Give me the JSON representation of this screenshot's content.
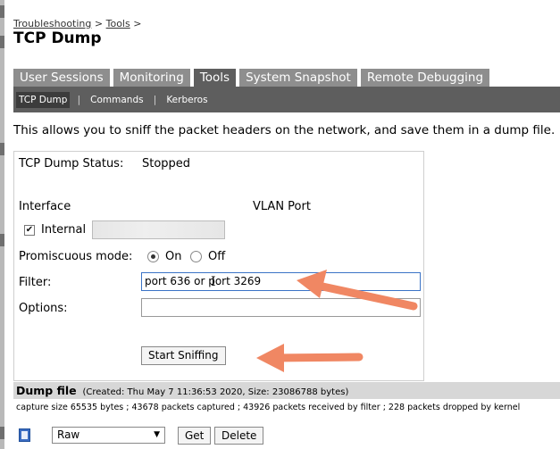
{
  "breadcrumb": {
    "link1": "Troubleshooting",
    "sep1": ">",
    "link2": "Tools",
    "sep2": ">"
  },
  "page_title": "TCP Dump",
  "tabs": [
    {
      "label": "User Sessions"
    },
    {
      "label": "Monitoring"
    },
    {
      "label": "Tools"
    },
    {
      "label": "System Snapshot"
    },
    {
      "label": "Remote Debugging"
    }
  ],
  "subnav": [
    {
      "label": "TCP Dump"
    },
    {
      "label": "Commands"
    },
    {
      "label": "Kerberos"
    }
  ],
  "subnav_sep": "|",
  "description": "This allows you to sniff the packet headers on the network, and save them in a dump file.",
  "panel": {
    "status_label": "TCP Dump Status:",
    "status_value": "Stopped",
    "interface_label": "Interface",
    "vlan_label": "VLAN Port",
    "internal_label": "Internal",
    "promiscuous_label": "Promiscuous mode:",
    "on_label": "On",
    "off_label": "Off",
    "filter_label": "Filter:",
    "filter_value": "port 636 or port 3269",
    "options_label": "Options:",
    "options_value": "",
    "start_button": "Start Sniffing"
  },
  "dump": {
    "title": "Dump file",
    "meta": "(Created: Thu May 7 11:36:53 2020, Size: 23086788 bytes)",
    "capture_line": "capture size 65535 bytes ; 43678 packets captured ; 43926 packets received by filter ; 228 packets dropped by kernel",
    "format_selected": "Raw",
    "get_button": "Get",
    "delete_button": "Delete"
  },
  "icons": {
    "checkbox": "✔",
    "chevron": "▼",
    "text_cursor": "I"
  },
  "colors": {
    "tab_bg": "#8e8e8e",
    "tab_active_bg": "#5e5e5e",
    "subnav_bg": "#5e5e5e",
    "annotation_arrow": "#f08763"
  }
}
